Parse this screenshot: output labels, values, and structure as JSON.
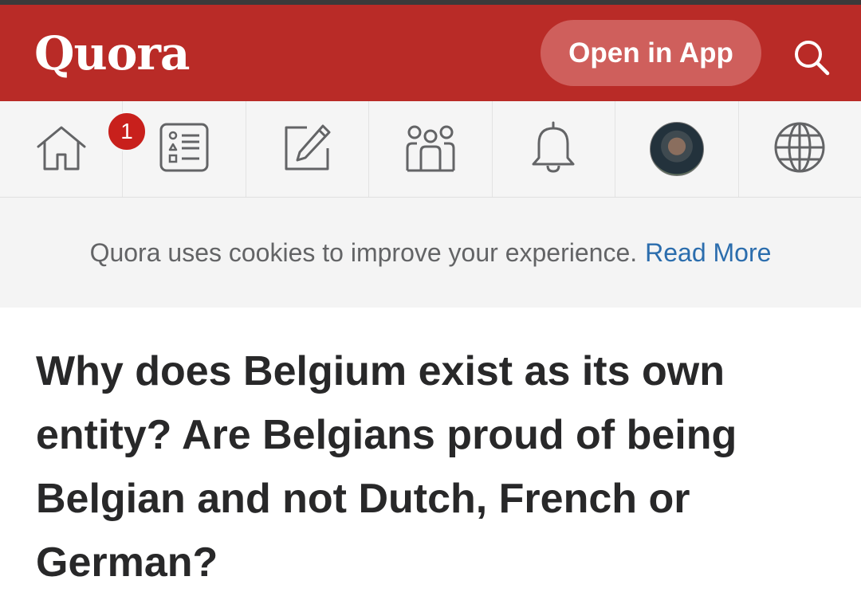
{
  "header": {
    "logo": "Quora",
    "open_app_label": "Open in App",
    "search_icon": "search-icon"
  },
  "nav": {
    "items": [
      {
        "name": "home",
        "icon": "home-icon",
        "badge": "1"
      },
      {
        "name": "answer",
        "icon": "list-icon"
      },
      {
        "name": "write",
        "icon": "pencil-square-icon"
      },
      {
        "name": "spaces",
        "icon": "people-icon"
      },
      {
        "name": "notifications",
        "icon": "bell-icon"
      },
      {
        "name": "profile",
        "icon": "avatar"
      },
      {
        "name": "language",
        "icon": "globe-icon"
      }
    ]
  },
  "cookie": {
    "text": "Quora uses cookies to improve your experience.",
    "link": "Read More"
  },
  "question": {
    "title": "Why does Belgium exist as its own entity? Are Belgians proud of being Belgian and not Dutch, French or German?"
  },
  "colors": {
    "brand": "#b92b27",
    "link": "#2b6dad",
    "badge": "#c8201c"
  }
}
